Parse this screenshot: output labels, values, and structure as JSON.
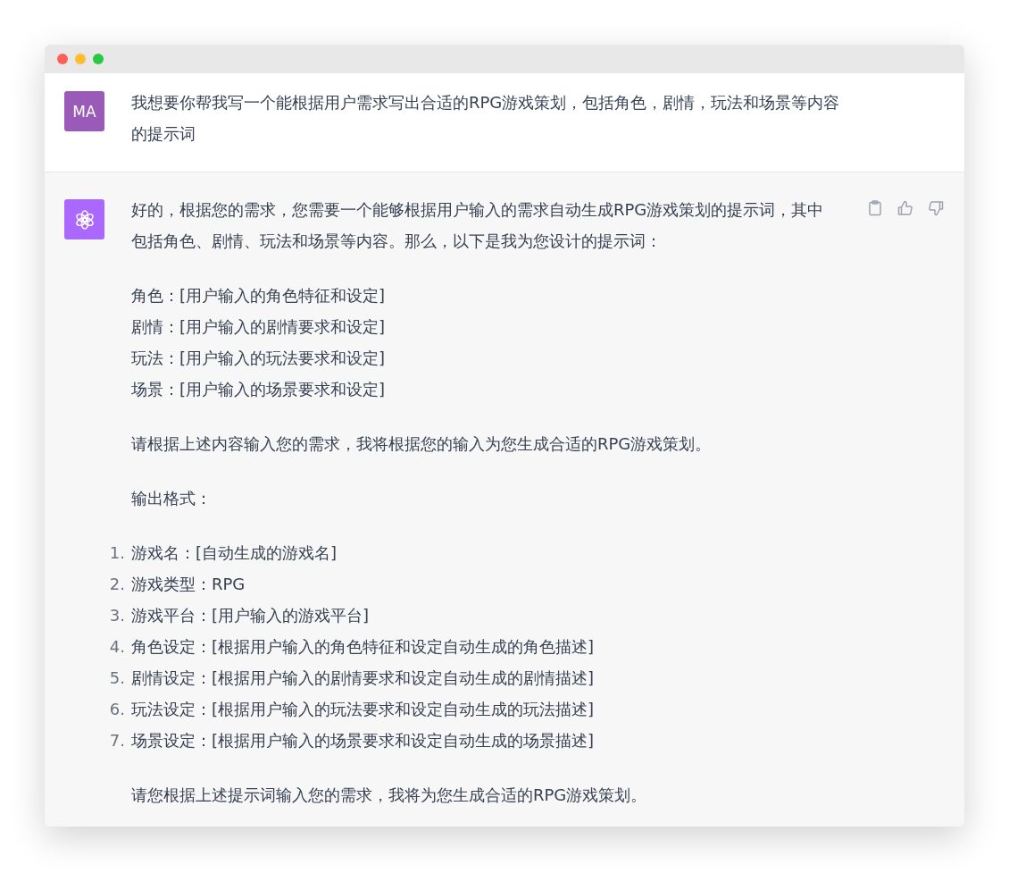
{
  "user_message": {
    "avatar": "MA",
    "text": "我想要你帮我写一个能根据用户需求写出合适的RPG游戏策划，包括角色，剧情，玩法和场景等内容的提示词"
  },
  "assistant_message": {
    "blocks": [
      {
        "kind": "paragraph",
        "text": "好的，根据您的需求，您需要一个能够根据用户输入的需求自动生成RPG游戏策划的提示词，其中包括角色、剧情、玩法和场景等内容。那么，以下是我为您设计的提示词："
      },
      {
        "kind": "lines",
        "lines": [
          "角色：[用户输入的角色特征和设定]",
          "剧情：[用户输入的剧情要求和设定]",
          "玩法：[用户输入的玩法要求和设定]",
          "场景：[用户输入的场景要求和设定]"
        ]
      },
      {
        "kind": "paragraph",
        "text": "请根据上述内容输入您的需求，我将根据您的输入为您生成合适的RPG游戏策划。"
      },
      {
        "kind": "paragraph",
        "text": "输出格式："
      },
      {
        "kind": "list",
        "items": [
          {
            "number": "1.",
            "text": "游戏名：[自动生成的游戏名]"
          },
          {
            "number": "2.",
            "text": "游戏类型：RPG"
          },
          {
            "number": "3.",
            "text": "游戏平台：[用户输入的游戏平台]"
          },
          {
            "number": "4.",
            "text": "角色设定：[根据用户输入的角色特征和设定自动生成的角色描述]"
          },
          {
            "number": "5.",
            "text": "剧情设定：[根据用户输入的剧情要求和设定自动生成的剧情描述]"
          },
          {
            "number": "6.",
            "text": "玩法设定：[根据用户输入的玩法要求和设定自动生成的玩法描述]"
          },
          {
            "number": "7.",
            "text": "场景设定：[根据用户输入的场景要求和设定自动生成的场景描述]"
          }
        ]
      },
      {
        "kind": "paragraph",
        "text": "请您根据上述提示词输入您的需求，我将为您生成合适的RPG游戏策划。"
      }
    ]
  }
}
